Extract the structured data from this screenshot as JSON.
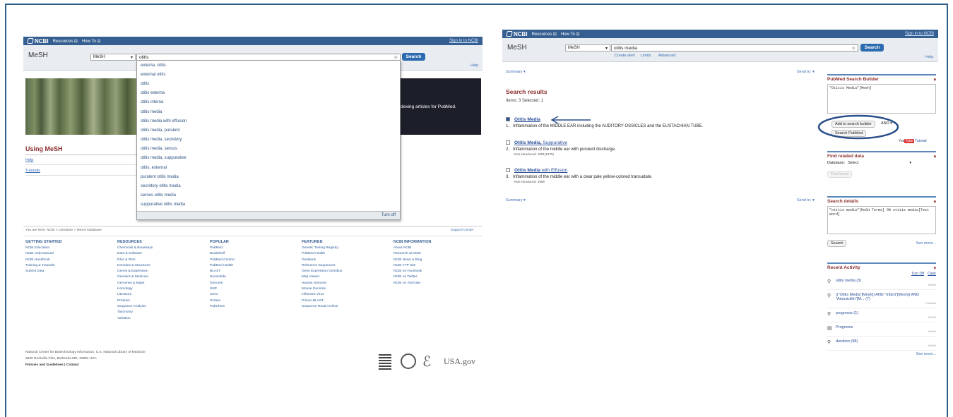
{
  "left": {
    "ncbi": {
      "logo": "NCBI",
      "resources": "Resources",
      "howto": "How To",
      "signin": "Sign in to NCBI"
    },
    "title": "MeSH",
    "db_select": "MeSH",
    "query": "otitis",
    "search_btn": "Search",
    "help": "Help",
    "autocomplete": [
      "externa, otitis",
      "external otitis",
      "otitis",
      "otitis externa",
      "otitis interna",
      "otitis media",
      "otitis media with effusion",
      "otitis media, purulent",
      "otitis media, secretory",
      "otitis media, serous",
      "otitis media, suppurative",
      "otitis, external",
      "purulent otitis media",
      "secretory otitis media",
      "serous otitis media",
      "suppurative otitis media"
    ],
    "turnoff": "Turn off",
    "banner_text": "dexing articles for PubMed.",
    "using_mesh": "Using MeSH",
    "help_link": "Help",
    "tutorials_link": "Tutorials",
    "breadcrumb": "You are here: NCBI > Literature > MeSH Database",
    "support": "Support Center",
    "footer": [
      {
        "h": "GETTING STARTED",
        "items": [
          "NCBI Education",
          "NCBI Help Manual",
          "NCBI Handbook",
          "Training & Tutorials",
          "Submit Data"
        ]
      },
      {
        "h": "RESOURCES",
        "items": [
          "Chemicals & Bioassays",
          "Data & Software",
          "DNA & RNA",
          "Domains & Structures",
          "Genes & Expression",
          "Genetics & Medicine",
          "Genomes & Maps",
          "Homology",
          "Literature",
          "Proteins",
          "Sequence Analysis",
          "Taxonomy",
          "Variation"
        ]
      },
      {
        "h": "POPULAR",
        "items": [
          "PubMed",
          "Bookshelf",
          "PubMed Central",
          "PubMed Health",
          "BLAST",
          "Nucleotide",
          "Genome",
          "SNP",
          "Gene",
          "Protein",
          "PubChem"
        ]
      },
      {
        "h": "FEATURED",
        "items": [
          "Genetic Testing Registry",
          "PubMed Health",
          "GenBank",
          "Reference Sequences",
          "Gene Expression Omnibus",
          "Map Viewer",
          "Human Genome",
          "Mouse Genome",
          "Influenza Virus",
          "Primer-BLAST",
          "Sequence Read Archive"
        ]
      },
      {
        "h": "NCBI INFORMATION",
        "items": [
          "About NCBI",
          "Research at NCBI",
          "NCBI News & Blog",
          "NCBI FTP Site",
          "NCBI on Facebook",
          "NCBI on Twitter",
          "NCBI on YouTube"
        ]
      }
    ],
    "nlm_line1": "National Center for Biotechnology Information, U.S. National Library of Medicine",
    "nlm_line2": "8600 Rockville Pike, Bethesda MD, 20894 USA",
    "nlm_line3": "Policies and Guidelines | Contact",
    "usagov": "USA.gov"
  },
  "right": {
    "ncbi": {
      "logo": "NCBI",
      "resources": "Resources",
      "howto": "How To",
      "signin": "Sign in to NCBI"
    },
    "title": "MeSH",
    "db_select": "MeSH",
    "query": "otitis media",
    "search_btn": "Search",
    "create_alert": "Create alert",
    "limits": "Limits",
    "advanced": "Advanced",
    "help": "Help",
    "summary": "Summary",
    "send_to": "Send to:",
    "results_title": "Search results",
    "items_line": "Items: 3   Selected: 1",
    "results": [
      {
        "num": "1.",
        "title_a": "Otitis Media",
        "title_b": "",
        "desc": "Inflammation of the MIDDLE EAR including the AUDITORY OSSICLES and the EUSTACHIAN TUBE.",
        "year": ""
      },
      {
        "num": "2.",
        "title_a": "Otitis Media,",
        "title_b": " Suppurative",
        "desc": "Inflammation of the middle ear with purulent discharge.",
        "year": "Year introduced: 1991(1979)"
      },
      {
        "num": "3.",
        "title_a": "Otitis Media",
        "title_b": " with Effusion",
        "desc": "Inflammation of the middle ear with a clear pale yellow-colored transudate.",
        "year": "Year introduced: 1966"
      }
    ],
    "builder": {
      "title": "PubMed Search Builder",
      "text": "\"Otitis Media\"[Mesh]",
      "add_btn": "Add to search builder",
      "and": "AND",
      "search_pubmed": "Search PubMed",
      "you": "You",
      "tube": "Tube",
      "tutorial": "Tutorial"
    },
    "related": {
      "title": "Find related data",
      "db_label": "Database:",
      "db_value": "Select",
      "find_btn": "Find items"
    },
    "details": {
      "title": "Search details",
      "text": "\"otitis media\"[MeSH Terms] OR otitis media[Text Word]",
      "search_btn": "Search",
      "see_more": "See more..."
    },
    "recent": {
      "title": "Recent Activity",
      "turnoff": "Turn Off",
      "clear": "Clear",
      "items": [
        {
          "text": "otitis media (3)",
          "tag": "MeSH"
        },
        {
          "text": "((\"Otitis Media\"[Mesh]) AND \"Infant\"[Mesh]) AND \"Amoxicillin\"[M... (7)",
          "tag": "PubMed"
        },
        {
          "text": "prognosis (1)",
          "tag": "MeSH"
        },
        {
          "text": "Prognosis",
          "tag": "MeSH"
        },
        {
          "text": "duration (98)",
          "tag": "MeSH"
        }
      ],
      "see_more": "See more..."
    }
  },
  "colors": {
    "ncbi_blue": "#365f91",
    "frame": "#2e5f8a",
    "heading_red": "#8b2e2e",
    "highlight_ellipse": "#2a4f8a"
  }
}
